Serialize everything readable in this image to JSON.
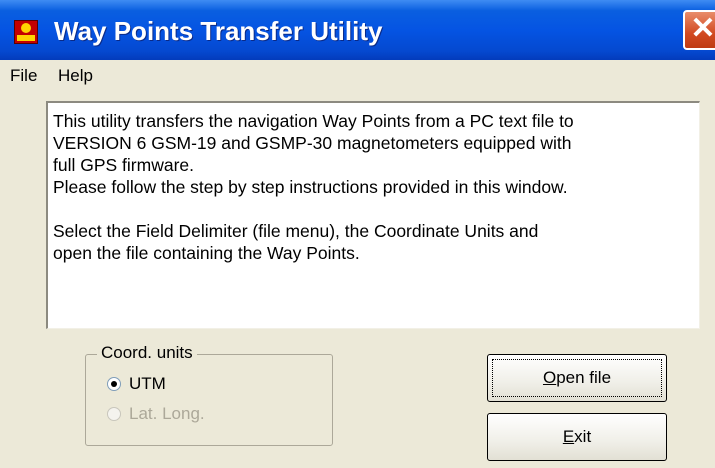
{
  "window": {
    "title": "Way Points Transfer Utility",
    "close_glyph": "✕"
  },
  "menu": {
    "items": [
      "File",
      "Help"
    ]
  },
  "info_text": [
    "This utility transfers the navigation Way Points from a PC text file to",
    "VERSION 6 GSM-19 and GSMP-30 magnetometers equipped with",
    "full GPS firmware.",
    "Please follow the step by step instructions provided in this window.",
    "",
    "Select the Field Delimiter (file menu), the Coordinate Units and",
    "open the file containing the Way Points."
  ],
  "coord_units": {
    "label": "Coord. units",
    "options": [
      {
        "label": "UTM",
        "selected": true,
        "enabled": true
      },
      {
        "label": "Lat. Long.",
        "selected": false,
        "enabled": false
      }
    ]
  },
  "buttons": {
    "open": {
      "label": "Open file",
      "mnemonic": "O"
    },
    "exit": {
      "label": "Exit",
      "mnemonic": "E"
    }
  },
  "colors": {
    "titlebar": "#0554e3",
    "close": "#d24a21",
    "face": "#ece9d8"
  },
  "icons": [
    "app-icon",
    "close-icon"
  ]
}
